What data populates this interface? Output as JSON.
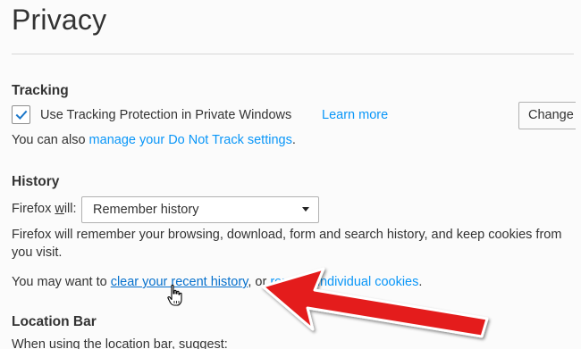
{
  "header": {
    "title": "Privacy"
  },
  "tracking": {
    "heading": "Tracking",
    "checkbox_checked": true,
    "checkbox_label": "Use Tracking Protection in Private Windows",
    "learn_more": "Learn more",
    "change_button": "Change Block List",
    "dnt_prefix": "You can also ",
    "dnt_link": "manage your Do Not Track settings",
    "dnt_suffix": "."
  },
  "history": {
    "heading": "History",
    "will_label_before": "Firefox ",
    "will_label_underlined": "w",
    "will_label_after": "ill:",
    "select_value": "Remember history",
    "description_line1": "Firefox will remember your browsing, download, form and search history, and keep cookies from",
    "description_line2": "you visit.",
    "want_prefix": "You may want to ",
    "clear_link": "clear your recent history",
    "or_text": ", or ",
    "remove_link": "remove individual cookies",
    "want_suffix": "."
  },
  "location_bar": {
    "heading": "Location Bar",
    "suggest_text": "When using the location bar, suggest:"
  },
  "colors": {
    "link": "#0996f8",
    "arrow": "#e41e1e",
    "text": "#333333"
  },
  "icons": {
    "checkbox": "checkmark-icon",
    "select": "dropdown-arrow-icon",
    "cursor": "hand-pointer-icon",
    "annotation": "red-arrow-icon"
  }
}
